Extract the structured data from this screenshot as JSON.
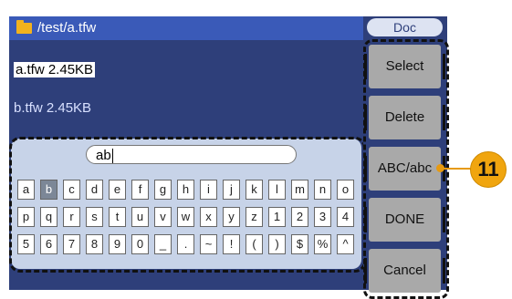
{
  "title_bar": {
    "path": "/test/a.tfw"
  },
  "files": [
    {
      "label": "a.tfw  2.45KB",
      "selected": true
    },
    {
      "label": "b.tfw  2.45KB",
      "selected": false
    }
  ],
  "keyboard": {
    "input_value": "ab",
    "highlighted_key": "b",
    "rows": [
      [
        "a",
        "b",
        "c",
        "d",
        "e",
        "f",
        "g",
        "h",
        "i",
        "j",
        "k",
        "l",
        "m",
        "n",
        "o"
      ],
      [
        "p",
        "q",
        "r",
        "s",
        "t",
        "u",
        "v",
        "w",
        "x",
        "y",
        "z",
        "1",
        "2",
        "3",
        "4"
      ],
      [
        "5",
        "6",
        "7",
        "8",
        "9",
        "0",
        "_",
        ".",
        "~",
        "!",
        "(",
        ")",
        "$",
        "%",
        "^"
      ]
    ]
  },
  "panel": {
    "tab_label": "Doc",
    "softkeys": [
      "Select",
      "Delete",
      "ABC/abc",
      "DONE",
      "Cancel"
    ]
  },
  "callout": {
    "number": "11"
  },
  "colors": {
    "screen": "#2e3f7a",
    "titlebar": "#3a5ab8",
    "keyboard": "#c7d3e8",
    "softkey": "#a9a9a9",
    "callout": "#f0a50f"
  }
}
